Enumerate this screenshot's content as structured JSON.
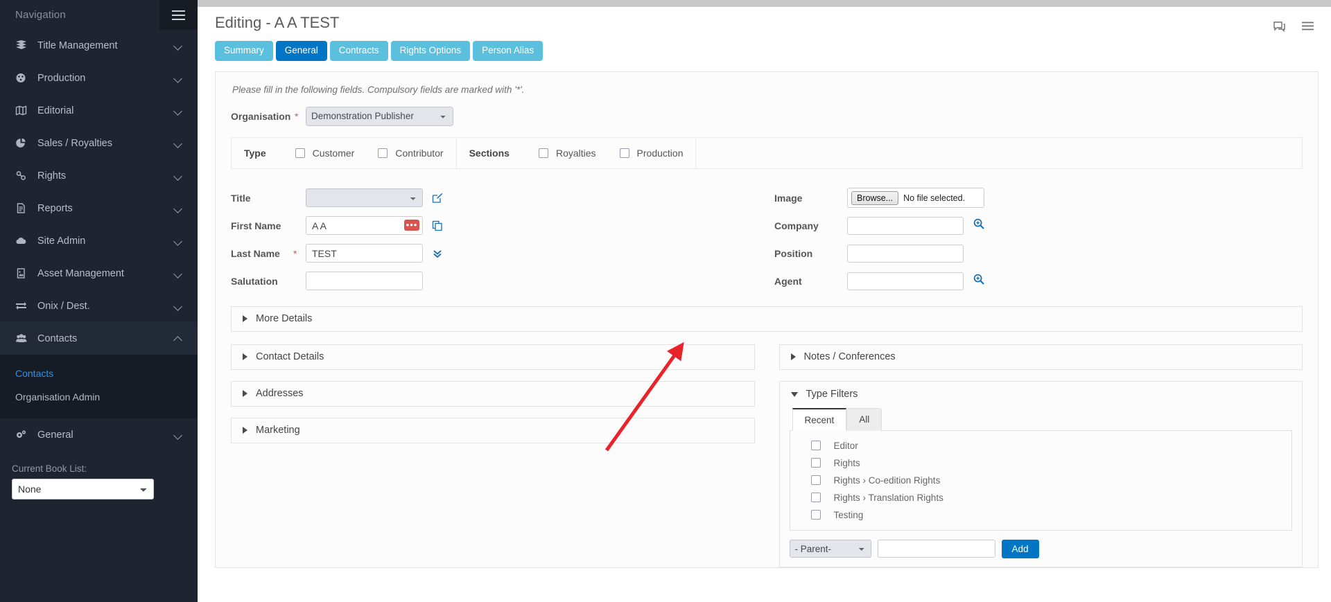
{
  "sidebar": {
    "nav_title": "Navigation",
    "burger_icon": "hamburger-menu-icon",
    "items": [
      {
        "label": "Title Management",
        "icon": "book-icon",
        "state": "collapsed"
      },
      {
        "label": "Production",
        "icon": "gauge-icon",
        "state": "collapsed"
      },
      {
        "label": "Editorial",
        "icon": "map-icon",
        "state": "collapsed"
      },
      {
        "label": "Sales / Royalties",
        "icon": "pie-chart-icon",
        "state": "collapsed"
      },
      {
        "label": "Rights",
        "icon": "link-icon",
        "state": "collapsed"
      },
      {
        "label": "Reports",
        "icon": "document-icon",
        "state": "collapsed"
      },
      {
        "label": "Site Admin",
        "icon": "cloud-icon",
        "state": "collapsed"
      },
      {
        "label": "Asset Management",
        "icon": "image-file-icon",
        "state": "collapsed"
      },
      {
        "label": "Onix / Dest.",
        "icon": "exchange-arrows-icon",
        "state": "collapsed"
      },
      {
        "label": "Contacts",
        "icon": "users-icon",
        "state": "expanded"
      },
      {
        "label": "General",
        "icon": "cogs-icon",
        "state": "collapsed"
      }
    ],
    "subnav": [
      {
        "label": "Contacts",
        "active": true
      },
      {
        "label": "Organisation Admin",
        "active": false
      }
    ],
    "book_list_label": "Current Book List:",
    "book_list_value": "None"
  },
  "header": {
    "title": "Editing - A A TEST",
    "icons": [
      {
        "name": "comment-icon"
      },
      {
        "name": "list-menu-icon"
      }
    ],
    "tabs": [
      {
        "label": "Summary",
        "active": false
      },
      {
        "label": "General",
        "active": true
      },
      {
        "label": "Contracts",
        "active": false
      },
      {
        "label": "Rights Options",
        "active": false
      },
      {
        "label": "Person Alias",
        "active": false
      }
    ]
  },
  "form": {
    "hint": "Please fill in the following fields. Compulsory fields are marked with '*'.",
    "organisation": {
      "label": "Organisation",
      "required_mark": "*",
      "value": "Demonstration Publisher"
    },
    "type_bar": {
      "type_label": "Type",
      "type_options": [
        {
          "label": "Customer",
          "checked": false
        },
        {
          "label": "Contributor",
          "checked": false
        }
      ],
      "sections_label": "Sections",
      "sections_options": [
        {
          "label": "Royalties",
          "checked": false
        },
        {
          "label": "Production",
          "checked": false
        }
      ]
    },
    "left_fields": [
      {
        "label": "Title",
        "required_mark": "",
        "type": "select",
        "value": "",
        "icon": "edit-pencil-icon"
      },
      {
        "label": "First Name",
        "required_mark": "",
        "type": "text",
        "value": "A A",
        "badge": "•••",
        "icon": "copy-icon"
      },
      {
        "label": "Last Name",
        "required_mark": "*",
        "type": "text",
        "value": "TEST",
        "icon": "double-chevron-down-icon"
      },
      {
        "label": "Salutation",
        "required_mark": "",
        "type": "text",
        "value": "",
        "icon": ""
      }
    ],
    "right_fields": {
      "image": {
        "label": "Image",
        "browse_label": "Browse...",
        "no_file_text": "No file selected."
      },
      "company": {
        "label": "Company",
        "value": "",
        "icon": "search-plus-icon"
      },
      "position": {
        "label": "Position",
        "value": "",
        "icon": ""
      },
      "agent": {
        "label": "Agent",
        "value": "",
        "icon": "search-plus-icon"
      }
    },
    "accordions": {
      "more_details": {
        "label": "More Details",
        "expanded": false
      },
      "left": [
        {
          "label": "Contact Details",
          "expanded": false
        },
        {
          "label": "Addresses",
          "expanded": false
        },
        {
          "label": "Marketing",
          "expanded": false
        }
      ],
      "right": [
        {
          "label": "Notes / Conferences",
          "expanded": false
        }
      ]
    },
    "type_filters": {
      "label": "Type Filters",
      "expanded": true,
      "tabs": [
        {
          "label": "Recent",
          "active": true
        },
        {
          "label": "All",
          "active": false
        }
      ],
      "items": [
        {
          "label": "Editor",
          "checked": false
        },
        {
          "label": "Rights",
          "checked": false
        },
        {
          "label": "Rights › Co-edition Rights",
          "checked": false
        },
        {
          "label": "Rights › Translation Rights",
          "checked": false
        },
        {
          "label": "Testing",
          "checked": false
        }
      ],
      "parent_select_value": "- Parent-",
      "new_type_value": "",
      "add_button_label": "Add"
    }
  },
  "annotation": {
    "arrow_color": "#e8232a",
    "points_to": "type-filters-recent-tab"
  },
  "colors": {
    "sidebar_bg": "#1e2430",
    "tab_active": "#0275c4",
    "tab_inactive": "#5bc0de",
    "required_star": "#d9534f",
    "link_active": "#2196f3"
  }
}
